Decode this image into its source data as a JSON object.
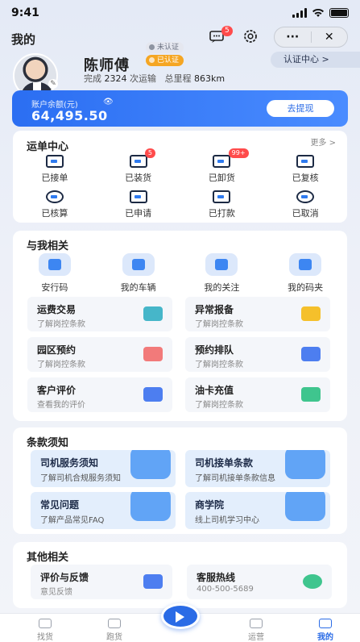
{
  "status_bar": {
    "time": "9:41"
  },
  "header": {
    "title": "我的",
    "message_badge": "5",
    "capsule_more": "···",
    "capsule_close": "✕"
  },
  "profile": {
    "name": "陈师傅",
    "tag_unverified": "未认证",
    "tag_verified": "已认证",
    "stats_prefix": "完成",
    "trips": "2324",
    "trips_suffix": "次运输",
    "mileage_label": "总里程",
    "mileage": "863km",
    "verify_center": "认证中心 >"
  },
  "balance": {
    "label": "账户余额(元)",
    "amount": "64,495.50",
    "withdraw": "去提现"
  },
  "orders": {
    "title": "运单中心",
    "more": "更多 >",
    "items": [
      {
        "label": "已接单",
        "badge": ""
      },
      {
        "label": "已装货",
        "badge": "5"
      },
      {
        "label": "已卸货",
        "badge": "99+"
      },
      {
        "label": "已复核",
        "badge": ""
      },
      {
        "label": "已核算",
        "badge": ""
      },
      {
        "label": "已申请",
        "badge": ""
      },
      {
        "label": "已打款",
        "badge": ""
      },
      {
        "label": "已取消",
        "badge": ""
      }
    ]
  },
  "related": {
    "title": "与我相关",
    "shortcuts": [
      {
        "label": "安行码"
      },
      {
        "label": "我的车辆"
      },
      {
        "label": "我的关注"
      },
      {
        "label": "我的码夹"
      }
    ],
    "tiles": [
      {
        "title": "运费交易",
        "sub": "了解岗控条款",
        "color": "#46b6c9"
      },
      {
        "title": "异常报备",
        "sub": "了解岗控条款",
        "color": "#f5c02b"
      },
      {
        "title": "园区预约",
        "sub": "了解岗控条款",
        "color": "#f27a7a"
      },
      {
        "title": "预约排队",
        "sub": "了解岗控条款",
        "color": "#4d7ef0"
      },
      {
        "title": "客户评价",
        "sub": "查看我的评价",
        "color": "#4d7ef0"
      },
      {
        "title": "油卡充值",
        "sub": "了解岗控条款",
        "color": "#3fc58e"
      }
    ]
  },
  "terms": {
    "title": "条款须知",
    "tiles": [
      {
        "title": "司机服务须知",
        "sub": "了解司机合规服务须知"
      },
      {
        "title": "司机接单条款",
        "sub": "了解司机接单条款信息"
      },
      {
        "title": "常见问题",
        "sub": "了解产品常见FAQ"
      },
      {
        "title": "商学院",
        "sub": "线上司机学习中心"
      }
    ]
  },
  "other": {
    "title": "其他相关",
    "tiles": [
      {
        "title": "评价与反馈",
        "sub": "意见反馈"
      },
      {
        "title": "客服热线",
        "sub": "400-500-5689"
      }
    ]
  },
  "tabbar": {
    "items": [
      {
        "label": "找货"
      },
      {
        "label": "跑货"
      },
      {
        "label": "运营"
      },
      {
        "label": "我的"
      }
    ]
  }
}
